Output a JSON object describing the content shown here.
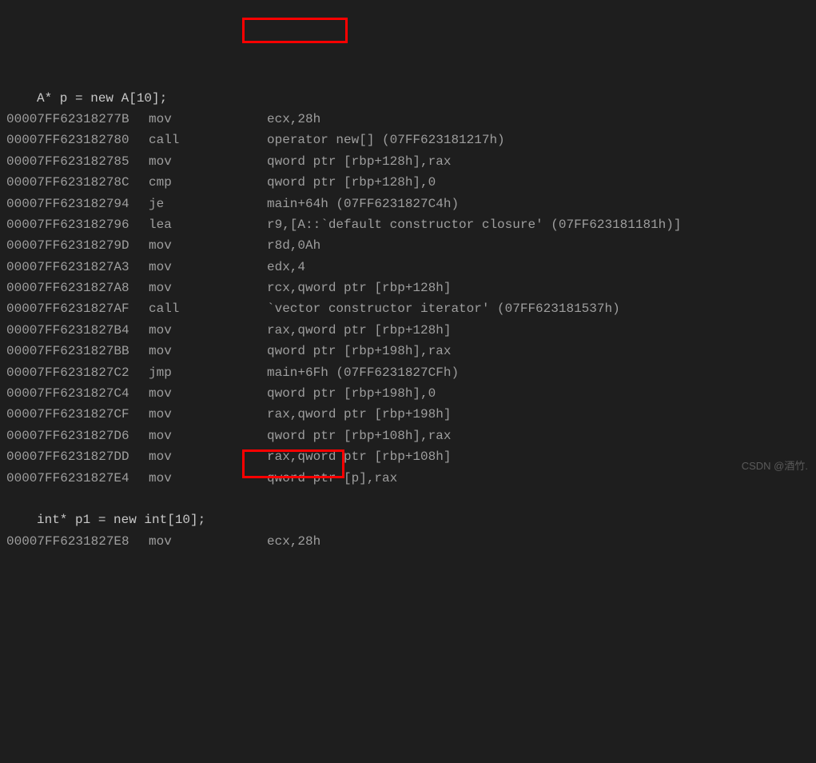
{
  "lines": [
    {
      "type": "source",
      "text": "A* p = new A[10];"
    },
    {
      "type": "asm",
      "addr": "00007FF62318277B",
      "op": "mov",
      "operand": "ecx,28h"
    },
    {
      "type": "asm",
      "addr": "00007FF623182780",
      "op": "call",
      "operand": "operator new[] (07FF623181217h)"
    },
    {
      "type": "asm",
      "addr": "00007FF623182785",
      "op": "mov",
      "operand": "qword ptr [rbp+128h],rax"
    },
    {
      "type": "asm",
      "addr": "00007FF62318278C",
      "op": "cmp",
      "operand": "qword ptr [rbp+128h],0"
    },
    {
      "type": "asm",
      "addr": "00007FF623182794",
      "op": "je",
      "operand": "main+64h (07FF6231827C4h)"
    },
    {
      "type": "asm",
      "addr": "00007FF623182796",
      "op": "lea",
      "operand": "r9,[A::`default constructor closure' (07FF623181181h)]"
    },
    {
      "type": "asm",
      "addr": "00007FF62318279D",
      "op": "mov",
      "operand": "r8d,0Ah"
    },
    {
      "type": "asm",
      "addr": "00007FF6231827A3",
      "op": "mov",
      "operand": "edx,4"
    },
    {
      "type": "asm",
      "addr": "00007FF6231827A8",
      "op": "mov",
      "operand": "rcx,qword ptr [rbp+128h]"
    },
    {
      "type": "asm",
      "addr": "00007FF6231827AF",
      "op": "call",
      "operand": "`vector constructor iterator' (07FF623181537h)"
    },
    {
      "type": "asm",
      "addr": "00007FF6231827B4",
      "op": "mov",
      "operand": "rax,qword ptr [rbp+128h]"
    },
    {
      "type": "asm",
      "addr": "00007FF6231827BB",
      "op": "mov",
      "operand": "qword ptr [rbp+198h],rax"
    },
    {
      "type": "asm",
      "addr": "00007FF6231827C2",
      "op": "jmp",
      "operand": "main+6Fh (07FF6231827CFh)"
    },
    {
      "type": "asm",
      "addr": "00007FF6231827C4",
      "op": "mov",
      "operand": "qword ptr [rbp+198h],0"
    },
    {
      "type": "asm",
      "addr": "00007FF6231827CF",
      "op": "mov",
      "operand": "rax,qword ptr [rbp+198h]"
    },
    {
      "type": "asm",
      "addr": "00007FF6231827D6",
      "op": "mov",
      "operand": "qword ptr [rbp+108h],rax"
    },
    {
      "type": "asm",
      "addr": "00007FF6231827DD",
      "op": "mov",
      "operand": "rax,qword ptr [rbp+108h]"
    },
    {
      "type": "asm",
      "addr": "00007FF6231827E4",
      "op": "mov",
      "operand": "qword ptr [p],rax"
    },
    {
      "type": "blank",
      "text": ""
    },
    {
      "type": "source",
      "text": "int* p1 = new int[10];"
    },
    {
      "type": "asm",
      "addr": "00007FF6231827E8",
      "op": "mov",
      "operand": "ecx,28h"
    }
  ],
  "watermark": "CSDN @酒竹."
}
